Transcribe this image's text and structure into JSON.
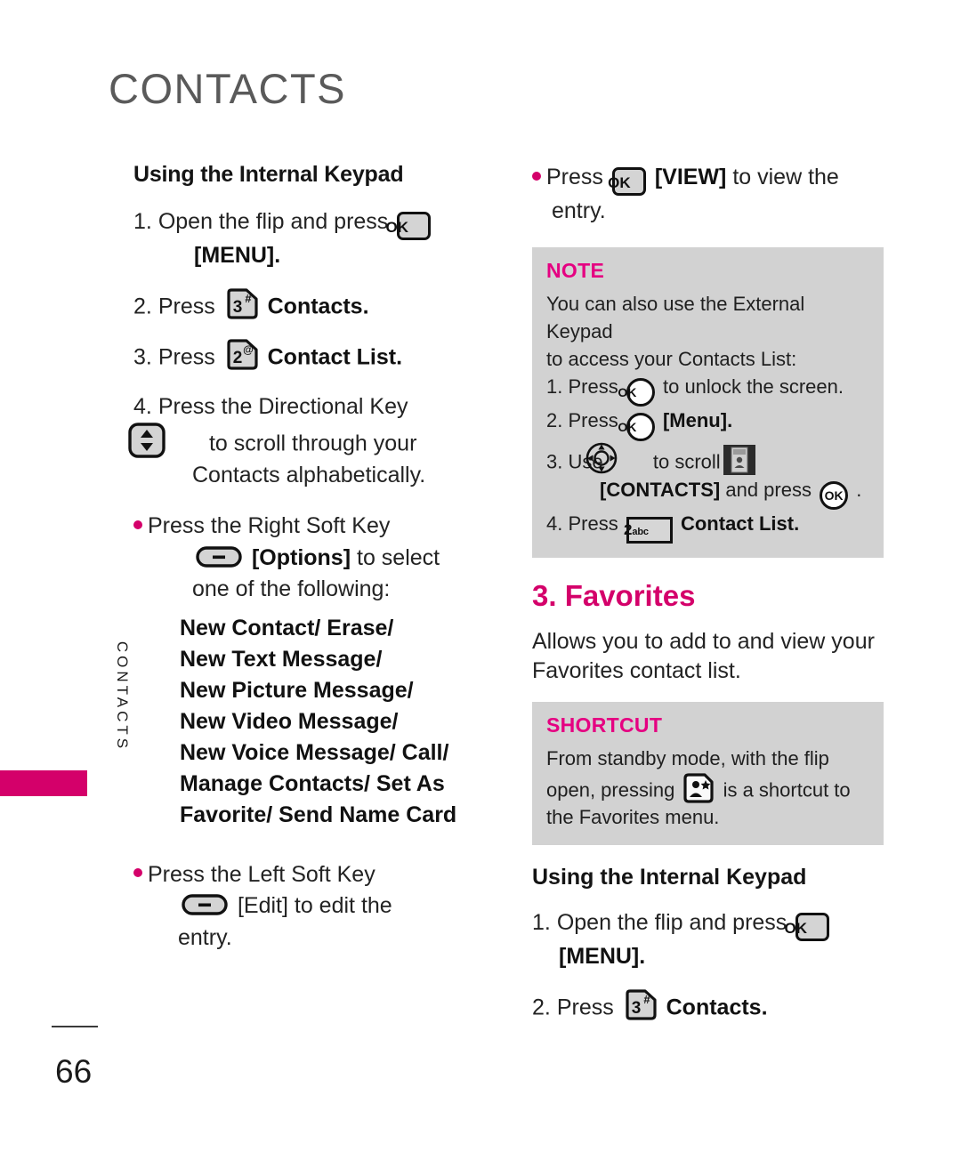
{
  "page": {
    "title": "CONTACTS",
    "side_tab_label": "CONTACTS",
    "page_number": "66",
    "accent_color": "#D4006A",
    "box_bg_color": "#d2d2d2"
  },
  "left_column": {
    "heading": "Using the Internal Keypad",
    "step1": {
      "num": "1.",
      "text_before": "Open the flip and press",
      "icon": "ok-key-icon",
      "text_after": "[MENU]."
    },
    "step2": {
      "num": "2.",
      "text_before": "Press",
      "icon": "key-3-hash-icon",
      "text_after": "Contacts."
    },
    "step3": {
      "num": "3.",
      "text_before": "Press",
      "icon": "key-2-at-icon",
      "text_after": "Contact List."
    },
    "step4": {
      "num": "4.",
      "text_before": "Press the Directional Key",
      "icon": "up-down-key-icon",
      "text_after": "to scroll through your Contacts alphabetically."
    },
    "bullet_options": {
      "line1": "Press the Right Soft Key",
      "icon": "soft-key-icon",
      "line2_bracket": "[Options]",
      "line2_rest": "to select",
      "line3": "one of the following:",
      "options": [
        "New Contact/ Erase/",
        "New Text Message/",
        "New Picture Message/",
        "New Video Message/",
        "New Voice Message/ Call/",
        "Manage Contacts/ Set As",
        "Favorite/ Send Name Card"
      ]
    },
    "bullet_edit": {
      "line1": "Press the Left Soft Key",
      "icon": "soft-key-icon",
      "line2_bracket": "[Edit]",
      "line2_rest": "to edit the",
      "line3": "entry."
    }
  },
  "right_column": {
    "bullet_view": {
      "text_before": "Press",
      "icon": "ok-key-icon",
      "bracket": "[VIEW]",
      "text_after": "to view the entry."
    },
    "note_box": {
      "title": "NOTE",
      "intro_line1": "You can also use the External Keypad",
      "intro_line2": "to access your Contacts List:",
      "steps": [
        {
          "num": "1.",
          "before": "Press",
          "icon": "ok-circle-icon",
          "after": "to unlock the screen."
        },
        {
          "num": "2.",
          "before": "Press",
          "icon": "ok-circle-icon",
          "after": "[Menu]."
        },
        {
          "num": "3.",
          "before": "Use",
          "icon": "nav-pad-icon",
          "mid": "to scroll to",
          "icon2": "contacts-thumb-icon",
          "sub_bracket": "[CONTACTS]",
          "sub_mid": "and press",
          "icon3": "ok-circle-icon",
          "sub_after": "."
        },
        {
          "num": "4.",
          "before": "Press",
          "icon": "key-2-abc-icon",
          "after": "Contact List."
        }
      ]
    },
    "favorites": {
      "heading": "3. Favorites",
      "description": "Allows you to add to and view your Favorites contact list."
    },
    "shortcut_box": {
      "title": "SHORTCUT",
      "line1": "From standby mode, with the flip",
      "line2_before": "open, pressing",
      "icon": "favorites-shortcut-icon",
      "line2_after": "is a shortcut to",
      "line3": "the Favorites menu."
    },
    "heading2": "Using the Internal Keypad",
    "step1": {
      "num": "1.",
      "text_before": "Open the flip and press",
      "icon": "ok-key-icon",
      "text_after": "[MENU]."
    },
    "step2": {
      "num": "2.",
      "text_before": "Press",
      "icon": "key-3-hash-icon",
      "text_after": "Contacts."
    }
  }
}
